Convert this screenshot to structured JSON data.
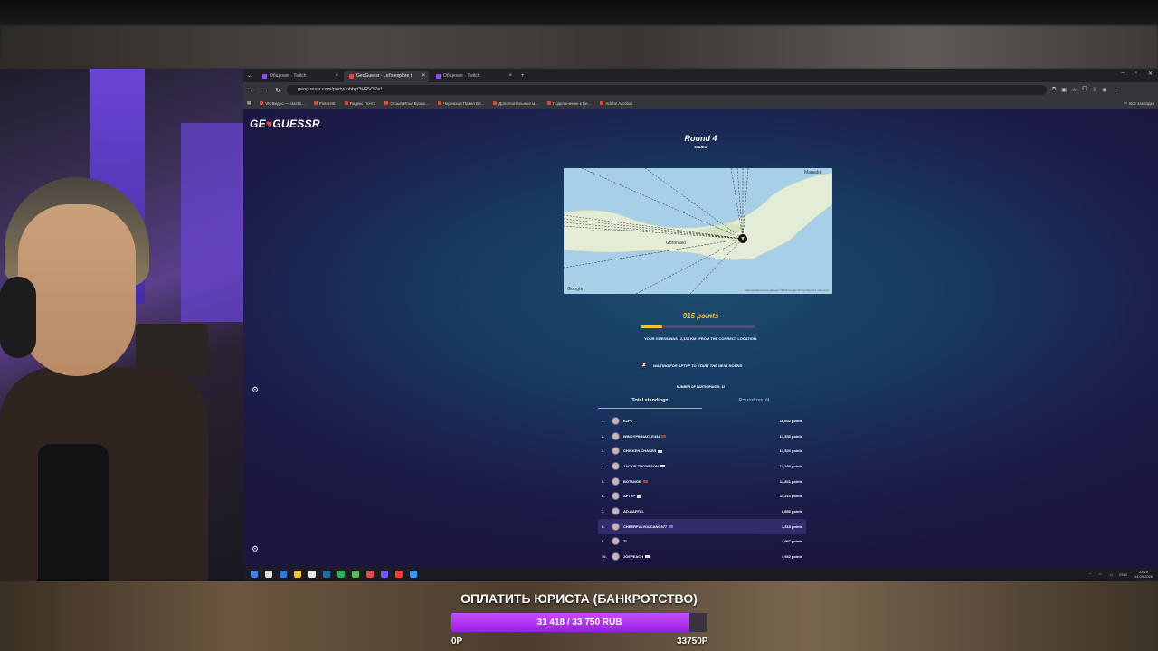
{
  "browser": {
    "tabs": [
      {
        "label": "Общение - Twitch",
        "active": false
      },
      {
        "label": "GeoGuessr - Let's explore t",
        "active": true
      },
      {
        "label": "Общение - Twitch",
        "active": false
      }
    ],
    "new_tab": "+",
    "url": "geoguessr.com/party/lobby/3HRV3?=1",
    "bookmarks": [
      "VK Видео — смотр...",
      "Pinterest",
      "Яндекс Почта",
      "Отзыв Илья Бузык...",
      "Черемхов Павел Вя...",
      "Дополнительные м...",
      "Подключение к Бе...",
      "Adobe Acrobat"
    ],
    "bookmarks_all": "Все закладки"
  },
  "game": {
    "logo_prefix": "GE",
    "logo_pin": "♥",
    "logo_suffix": "GUESSR",
    "round_title": "Round 4",
    "round_status": "ENDED",
    "map_labels": {
      "manado": "Manado",
      "gorontalo": "Gorontalo",
      "region": "GORONTALO"
    },
    "points": "915 points",
    "points_fraction": 0.18,
    "guess_prefix": "YOUR GUESS WAS",
    "guess_km": "2,133 KM",
    "guess_suffix": "FROM THE CORRECT LOCATION.",
    "waiting": "WAITING FOR АРТУР TO START THE NEXT ROUND",
    "participants": "NUMBER OF PARTICIPANTS: 12",
    "tab_total": "Total standings",
    "tab_round": "Round result",
    "google": "Google",
    "map_attr": "Картографические данные ©2026 Google  Terms  Report a map error"
  },
  "standings": [
    {
      "rank": "1.",
      "name": "EZPZ",
      "points": "16,602 points",
      "flag": ""
    },
    {
      "rank": "2.",
      "name": "WINDYPINNACLE434",
      "points": "13,553 points",
      "flag": "#d22"
    },
    {
      "rank": "3.",
      "name": "CHICKEN CHASER",
      "points": "13,524 points",
      "flag": "#ddd"
    },
    {
      "rank": "4.",
      "name": "JACKIE THOMPSON",
      "points": "13,398 points",
      "flag": "#ddd"
    },
    {
      "rank": "5.",
      "name": "BOTANGE",
      "points": "12,811 points",
      "flag": "#d22"
    },
    {
      "rank": "6.",
      "name": "АРТУР",
      "points": "11,215 points",
      "flag": "#ddd"
    },
    {
      "rank": "7.",
      "name": "AD-RAFFAL",
      "points": "8,856 points",
      "flag": ""
    },
    {
      "rank": "8.",
      "name": "CHEERFULVOLCANO377",
      "points": "7,318 points",
      "flag": "#7a6cff"
    },
    {
      "rank": "9.",
      "name": "TI",
      "points": "4,997 points",
      "flag": ""
    },
    {
      "rank": "10.",
      "name": "JOEPEACH",
      "points": "4,932 points",
      "flag": "#ddd"
    }
  ],
  "taskbar": {
    "lang": "ENG",
    "time": "23:29",
    "date": "14.09.2026"
  },
  "donation": {
    "title": "ОПЛАТИТЬ ЮРИСТА (БАНКРОТСТВО)",
    "progress_text": "31 418 / 33 750 RUB",
    "progress_fraction": 0.931,
    "min_label": "0Р",
    "max_label": "33750Р"
  },
  "colors": {
    "accent_gold": "#f5c333",
    "donation_purple": "#b43cf0",
    "tab_underline": "#a79cff"
  }
}
